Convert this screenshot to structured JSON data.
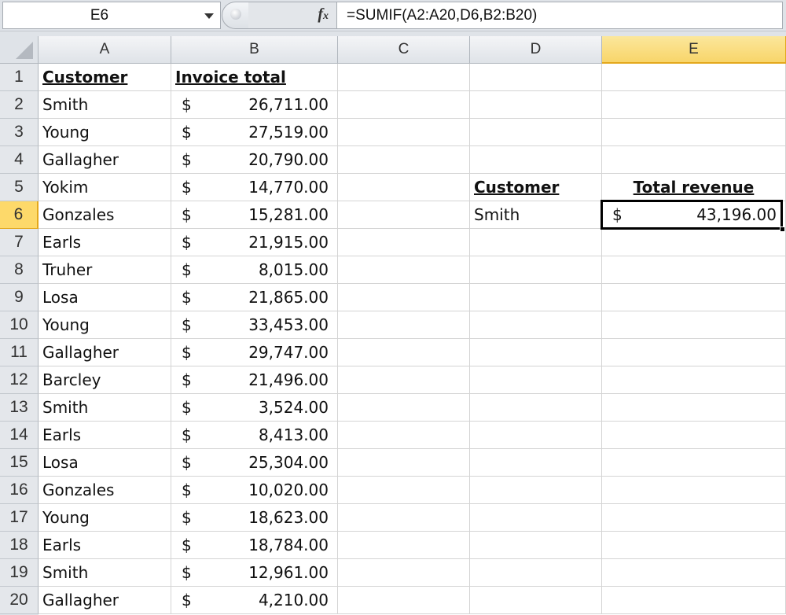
{
  "formula_bar": {
    "name_box": "E6",
    "fx_icon": "fx-icon",
    "formula": "=SUMIF(A2:A20,D6,B2:B20)"
  },
  "columns": [
    "A",
    "B",
    "C",
    "D",
    "E"
  ],
  "active_column": "E",
  "active_row": "6",
  "rows": [
    {
      "num": "1",
      "A": "Customer",
      "B": "Invoice total"
    },
    {
      "num": "2",
      "A": "Smith",
      "B_sym": "$",
      "B": "26,711.00"
    },
    {
      "num": "3",
      "A": "Young",
      "B_sym": "$",
      "B": "27,519.00"
    },
    {
      "num": "4",
      "A": "Gallagher",
      "B_sym": "$",
      "B": "20,790.00"
    },
    {
      "num": "5",
      "A": "Yokim",
      "B_sym": "$",
      "B": "14,770.00",
      "D": "Customer",
      "E": "Total revenue"
    },
    {
      "num": "6",
      "A": "Gonzales",
      "B_sym": "$",
      "B": "15,281.00",
      "D": "Smith",
      "E_sym": "$",
      "E": "43,196.00"
    },
    {
      "num": "7",
      "A": "Earls",
      "B_sym": "$",
      "B": "21,915.00"
    },
    {
      "num": "8",
      "A": "Truher",
      "B_sym": "$",
      "B": "8,015.00"
    },
    {
      "num": "9",
      "A": "Losa",
      "B_sym": "$",
      "B": "21,865.00"
    },
    {
      "num": "10",
      "A": "Young",
      "B_sym": "$",
      "B": "33,453.00"
    },
    {
      "num": "11",
      "A": "Gallagher",
      "B_sym": "$",
      "B": "29,747.00"
    },
    {
      "num": "12",
      "A": "Barcley",
      "B_sym": "$",
      "B": "21,496.00"
    },
    {
      "num": "13",
      "A": "Smith",
      "B_sym": "$",
      "B": "3,524.00"
    },
    {
      "num": "14",
      "A": "Earls",
      "B_sym": "$",
      "B": "8,413.00"
    },
    {
      "num": "15",
      "A": "Losa",
      "B_sym": "$",
      "B": "25,304.00"
    },
    {
      "num": "16",
      "A": "Gonzales",
      "B_sym": "$",
      "B": "10,020.00"
    },
    {
      "num": "17",
      "A": "Young",
      "B_sym": "$",
      "B": "18,623.00"
    },
    {
      "num": "18",
      "A": "Earls",
      "B_sym": "$",
      "B": "18,784.00"
    },
    {
      "num": "19",
      "A": "Smith",
      "B_sym": "$",
      "B": "12,961.00"
    },
    {
      "num": "20",
      "A": "Gallagher",
      "B_sym": "$",
      "B": "4,210.00"
    }
  ]
}
